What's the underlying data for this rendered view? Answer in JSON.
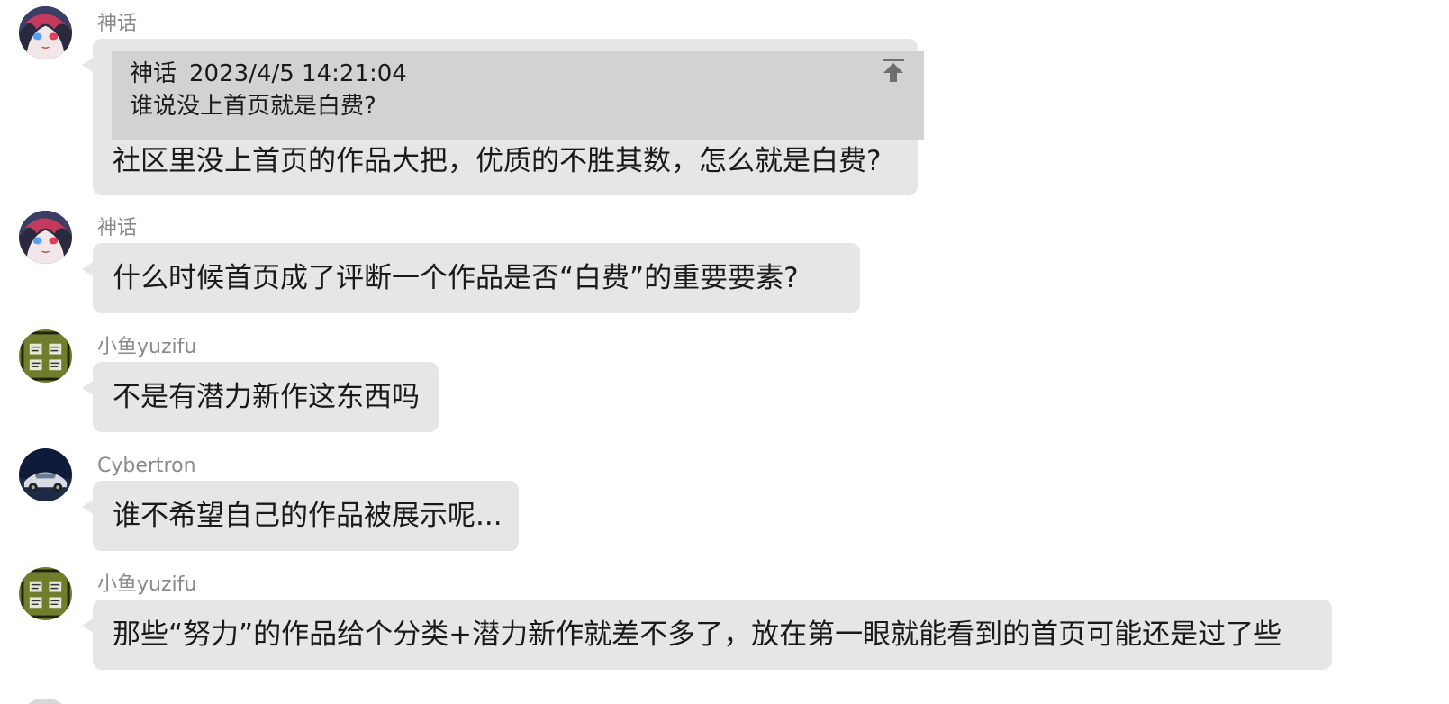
{
  "messages": [
    {
      "sender": "神话",
      "avatar": "anime-girl-avatar",
      "quote": {
        "sender": "神话",
        "time": "2023/4/5 14:21:04",
        "text": "谁说没上首页就是白费?",
        "pin_icon": "scroll-to-quote-icon"
      },
      "text": "社区里没上首页的作品大把，优质的不胜其数，怎么就是白费?"
    },
    {
      "sender": "神话",
      "avatar": "anime-girl-avatar",
      "text": "什么时候首页成了评断一个作品是否“白费”的重要要素?"
    },
    {
      "sender": "小鱼yuzifu",
      "avatar": "green-pattern-avatar",
      "text": "不是有潜力新作这东西吗"
    },
    {
      "sender": "Cybertron",
      "avatar": "car-photo-avatar",
      "text": "谁不希望自己的作品被展示呢..."
    },
    {
      "sender": "小鱼yuzifu",
      "avatar": "green-pattern-avatar",
      "text": "那些“努力”的作品给个分类+潜力新作就差不多了，放在第一眼就能看到的首页可能还是过了些"
    }
  ],
  "colors": {
    "bubble": "#e6e6e6",
    "quote_bg": "#d2d2d2",
    "sender_text": "#8a8a8a",
    "message_text": "#1a1a1a"
  }
}
